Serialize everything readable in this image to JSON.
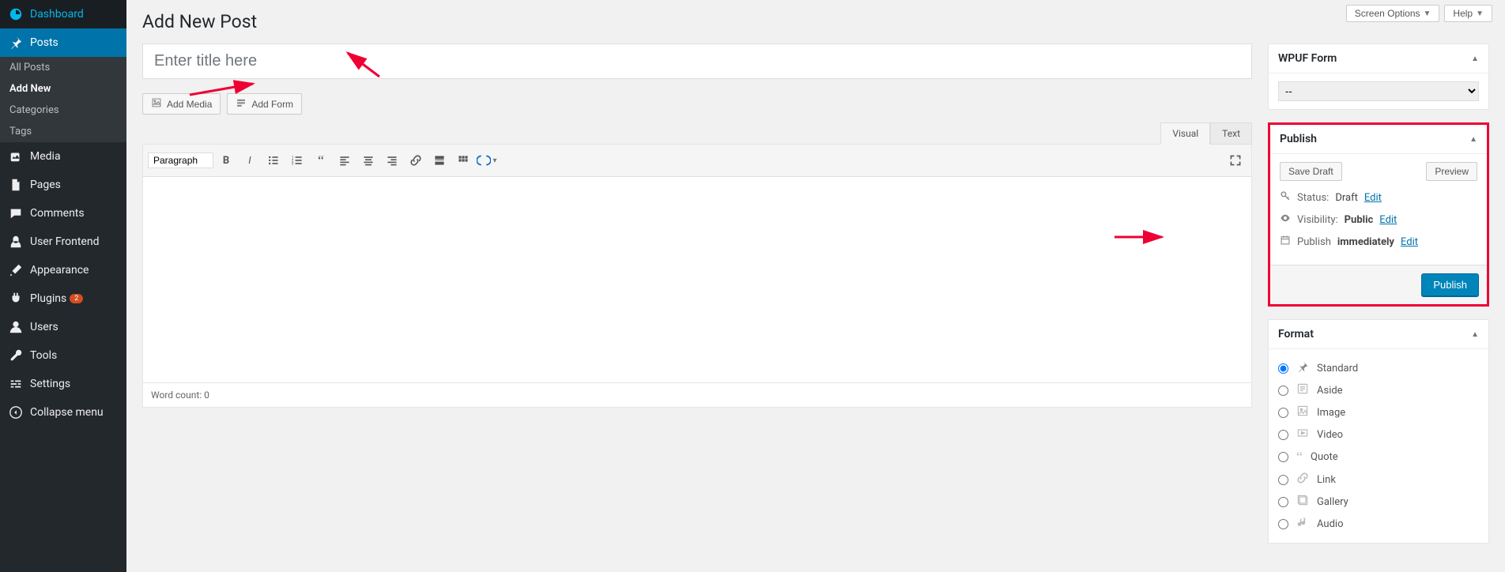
{
  "sidebar": {
    "items": [
      {
        "label": "Dashboard"
      },
      {
        "label": "Posts"
      },
      {
        "label": "Media"
      },
      {
        "label": "Pages"
      },
      {
        "label": "Comments"
      },
      {
        "label": "User Frontend"
      },
      {
        "label": "Appearance"
      },
      {
        "label": "Plugins",
        "badge": "2"
      },
      {
        "label": "Users"
      },
      {
        "label": "Tools"
      },
      {
        "label": "Settings"
      },
      {
        "label": "Collapse menu"
      }
    ],
    "submenu": [
      {
        "label": "All Posts"
      },
      {
        "label": "Add New"
      },
      {
        "label": "Categories"
      },
      {
        "label": "Tags"
      }
    ]
  },
  "topbar": {
    "screen_options": "Screen Options",
    "help": "Help"
  },
  "page": {
    "title": "Add New Post"
  },
  "title_input": {
    "placeholder": "Enter title here"
  },
  "editor": {
    "add_media": "Add Media",
    "add_form": "Add Form",
    "tabs": {
      "visual": "Visual",
      "text": "Text"
    },
    "paragraph": "Paragraph",
    "word_count_label": "Word count: 0"
  },
  "metabox": {
    "wpuf": {
      "title": "WPUF Form",
      "selected": "--"
    },
    "publish": {
      "title": "Publish",
      "save_draft": "Save Draft",
      "preview": "Preview",
      "status_label": "Status:",
      "status_value": "Draft",
      "edit": "Edit",
      "visibility_label": "Visibility:",
      "visibility_value": "Public",
      "publish_label": "Publish",
      "publish_value": "immediately",
      "publish_btn": "Publish"
    },
    "format": {
      "title": "Format",
      "options": [
        {
          "label": "Standard",
          "checked": true
        },
        {
          "label": "Aside"
        },
        {
          "label": "Image"
        },
        {
          "label": "Video"
        },
        {
          "label": "Quote"
        },
        {
          "label": "Link"
        },
        {
          "label": "Gallery"
        },
        {
          "label": "Audio"
        }
      ]
    }
  }
}
